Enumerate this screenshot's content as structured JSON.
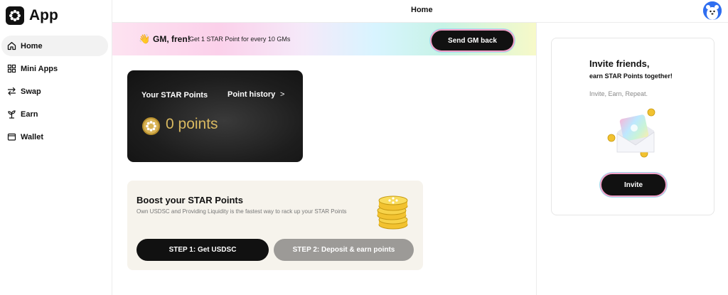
{
  "app": {
    "name": "App"
  },
  "topbar": {
    "title": "Home"
  },
  "sidebar": {
    "items": [
      {
        "label": "Home",
        "icon": "home-icon",
        "active": true
      },
      {
        "label": "Mini Apps",
        "icon": "grid-icon",
        "active": false
      },
      {
        "label": "Swap",
        "icon": "swap-icon",
        "active": false
      },
      {
        "label": "Earn",
        "icon": "sprout-icon",
        "active": false
      },
      {
        "label": "Wallet",
        "icon": "wallet-icon",
        "active": false
      }
    ]
  },
  "gm_banner": {
    "title": "GM, fren!",
    "subtitle": "Get 1 STAR Point for every 10 GMs",
    "button_label": "Send GM back",
    "icon": "waving-hand-icon"
  },
  "points_card": {
    "label": "Your STAR Points",
    "history_label": "Point history",
    "history_chevron": ">",
    "value": "0 points",
    "icon": "star-coin-icon"
  },
  "boost": {
    "title": "Boost your STAR Points",
    "description": "Own USDSC and Providing Liquidity is the fastest way to rack up your STAR Points",
    "step1_label": "STEP 1: Get USDSC",
    "step2_label": "STEP 2: Deposit & earn points",
    "icon": "coin-stack-icon"
  },
  "invite": {
    "title": "Invite friends,",
    "subtitle": "earn STAR Points together!",
    "tagline": "Invite, Earn, Repeat.",
    "button_label": "Invite",
    "icon": "envelope-icon"
  },
  "colors": {
    "accent_dark": "#111111",
    "coin_gold": "#d9b960",
    "avatar_blue": "#2f6ef0",
    "boost_bg": "#f6f3ec",
    "step2_gray": "#9c9a97"
  }
}
